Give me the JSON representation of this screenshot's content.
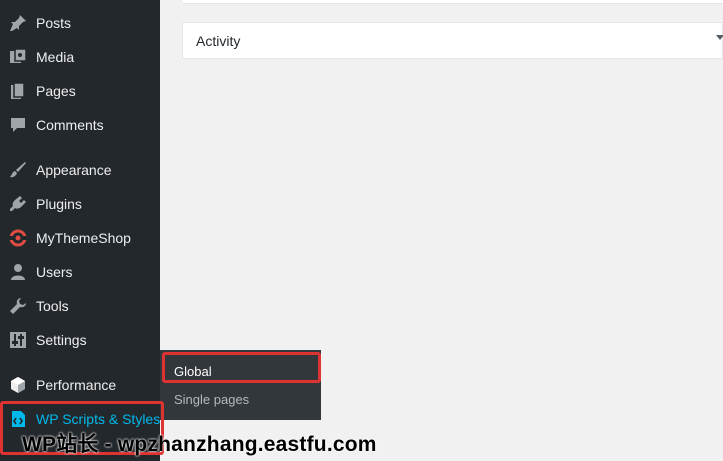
{
  "sidebar": {
    "items": [
      {
        "label": "Posts",
        "icon": "pushpin-icon"
      },
      {
        "label": "Media",
        "icon": "media-icon"
      },
      {
        "label": "Pages",
        "icon": "pages-icon"
      },
      {
        "label": "Comments",
        "icon": "comment-icon"
      },
      {
        "label": "Appearance",
        "icon": "brush-icon"
      },
      {
        "label": "Plugins",
        "icon": "plug-icon"
      },
      {
        "label": "MyThemeShop",
        "icon": "mythemeshop-icon"
      },
      {
        "label": "Users",
        "icon": "user-icon"
      },
      {
        "label": "Tools",
        "icon": "wrench-icon"
      },
      {
        "label": "Settings",
        "icon": "settings-icon"
      },
      {
        "label": "Performance",
        "icon": "performance-icon"
      },
      {
        "label": "WP Scripts & Styles",
        "icon": "code-icon"
      }
    ]
  },
  "dashboard": {
    "activity_title": "Activity"
  },
  "flyout": {
    "items": [
      {
        "label": "Global"
      },
      {
        "label": "Single pages"
      }
    ]
  },
  "watermark": "WP站长 - wpzhanzhang.eastfu.com",
  "colors": {
    "sidebar_bg": "#23282d",
    "flyout_bg": "#32373c",
    "active_text": "#00b9eb",
    "highlight": "#dd3333",
    "mythemeshop_icon": "#e14d43"
  }
}
